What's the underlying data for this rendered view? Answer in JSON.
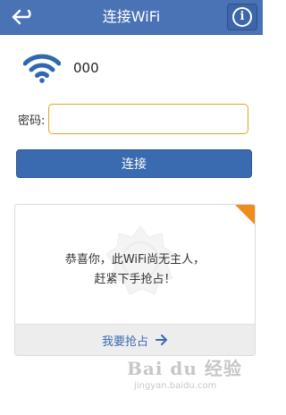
{
  "header": {
    "title": "连接WiFi",
    "back_icon": "back-arrow-icon",
    "info_glyph": "i",
    "color": "#4a73b6"
  },
  "network": {
    "name": "000",
    "icon": "wifi-icon",
    "icon_color": "#2f68b0"
  },
  "password": {
    "label": "密码:",
    "value": "",
    "border_color": "#e0a623"
  },
  "connect_button": {
    "label": "连接",
    "color": "#3a6ab0"
  },
  "promo": {
    "line1": "恭喜你，此WiFi尚无主人，",
    "line2": "赶紧下手抢占！",
    "action_label": "我要抢占",
    "corner_color": "#f08c1e"
  },
  "watermark": {
    "logo": "Bai du 经验",
    "url": "jingyan.baidu.com"
  }
}
